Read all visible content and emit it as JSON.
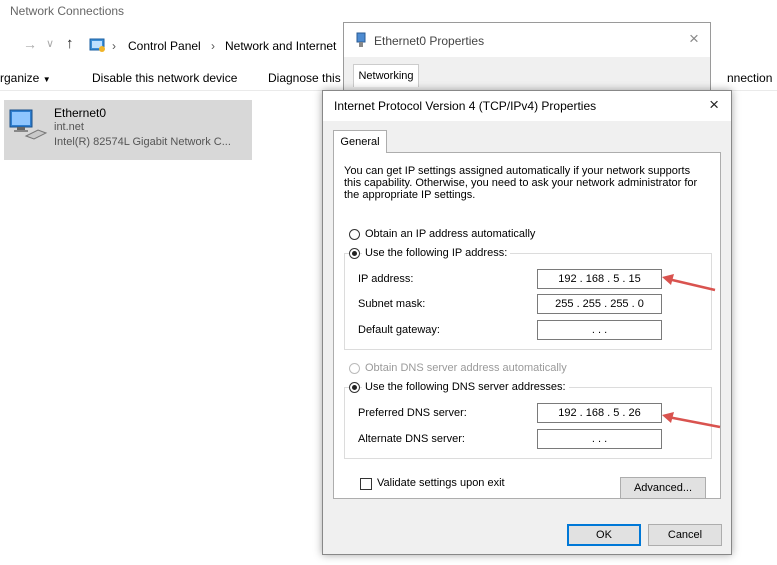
{
  "explorer": {
    "title": "Network Connections",
    "nav": {
      "back": "→",
      "down": "∨",
      "up": "↑",
      "sep": "›"
    },
    "breadcrumb": [
      "Control Panel",
      "Network and Internet"
    ],
    "commands": {
      "organize": "rganize",
      "organize_caret": "▼",
      "disable": "Disable this network device",
      "diagnose": "Diagnose this",
      "connection_tail": "nnection"
    },
    "item": {
      "name": "Ethernet0",
      "network": "int.net",
      "adapter": "Intel(R) 82574L Gigabit Network C..."
    }
  },
  "eth_dialog": {
    "title": "Ethernet0 Properties",
    "close": "×",
    "tab": "Networking"
  },
  "ipv4_dialog": {
    "title": "Internet Protocol Version 4 (TCP/IPv4) Properties",
    "close": "×",
    "tab": "General",
    "intro": "You can get IP settings assigned automatically if your network supports this capability. Otherwise, you need to ask your network administrator for the appropriate IP settings.",
    "ip_auto_label": "Obtain an IP address automatically",
    "ip_manual_label": "Use the following IP address:",
    "ip_address_label": "IP address:",
    "ip_address_value": "192 . 168 .  5  . 15",
    "subnet_label": "Subnet mask:",
    "subnet_value": "255 . 255 . 255 .  0",
    "gateway_label": "Default gateway:",
    "gateway_value": ".      .      .",
    "dns_auto_label": "Obtain DNS server address automatically",
    "dns_manual_label": "Use the following DNS server addresses:",
    "preferred_dns_label": "Preferred DNS server:",
    "preferred_dns_value": "192 . 168 .  5  . 26",
    "alternate_dns_label": "Alternate DNS server:",
    "alternate_dns_value": ".      .      .",
    "validate_label": "Validate settings upon exit",
    "advanced_button": "Advanced...",
    "ok_button": "OK",
    "cancel_button": "Cancel"
  },
  "colors": {
    "annotation_arrow": "#d9534f",
    "focus_blue": "#0078d7",
    "item_selected": "#d8d8d8"
  }
}
